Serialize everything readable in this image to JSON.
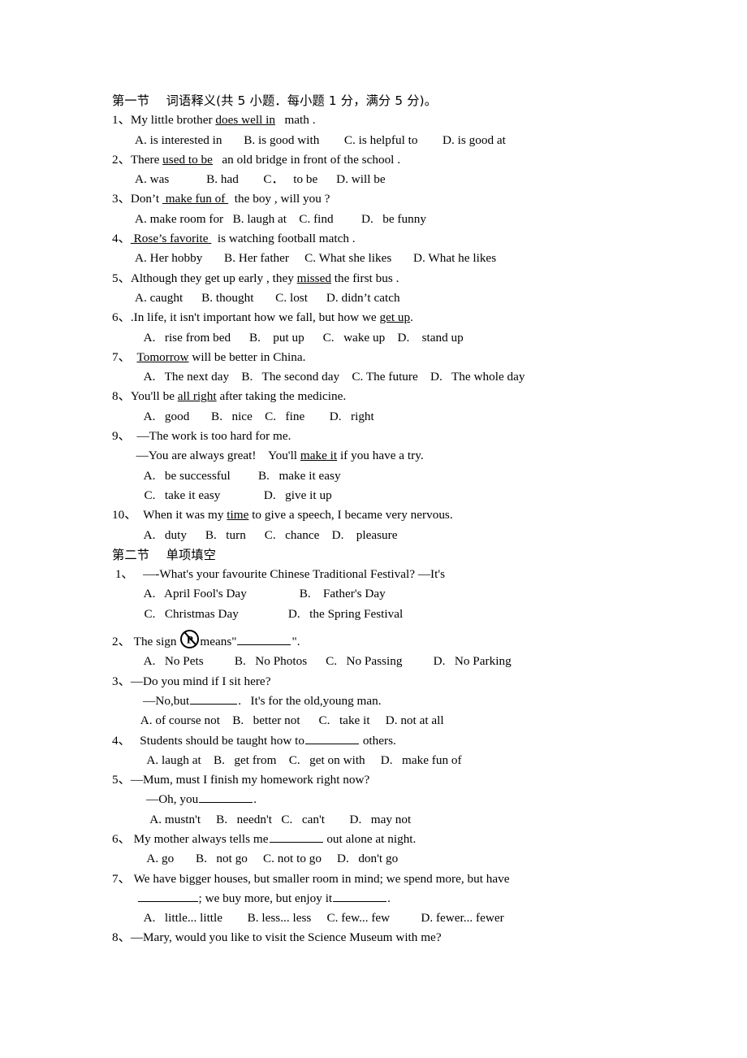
{
  "document": {
    "type": "english-exam-paper",
    "sections": [
      {
        "heading": "第一节　 词语释义(共 5 小题．每小题 1 分，满分 5 分)。",
        "questions": [
          {
            "number": "1、",
            "stem_pre": "My little brother ",
            "stem_underlined": "does well in",
            "stem_post": "   math .",
            "options_lines": [
              "A. is interested in       B. is good with        C. is helpful to        D. is good at"
            ]
          },
          {
            "number": "2、",
            "stem_pre": "There ",
            "stem_underlined": "used to be",
            "stem_post": "   an old bridge in front of the school .",
            "options_lines": [
              "A. was            B. had        C．   to be      D. will be"
            ]
          },
          {
            "number": "3、",
            "stem_pre": "Don’t ",
            "stem_underlined": " make fun of ",
            "stem_post": "  the boy , will you ?",
            "options_lines": [
              "A. make room for   B. laugh at    C. find         D.   be funny"
            ]
          },
          {
            "number": "4、",
            "stem_pre": "",
            "stem_underlined": " Rose’s favorite ",
            "stem_post": "  is watching football match .",
            "options_lines": [
              "A. Her hobby       B. Her father     C. What she likes       D. What he likes"
            ]
          },
          {
            "number": "5、",
            "stem_pre": "Although they get up early , they ",
            "stem_underlined": "missed",
            "stem_post": " the first bus .",
            "options_lines": [
              "A. caught      B. thought       C. lost      D. didn’t catch"
            ]
          },
          {
            "number": "6、",
            "stem_pre": ".In life, it isn't important how we fall, but how we ",
            "stem_underlined": "get up",
            "stem_post": ".",
            "options_lines": [
              "   A.   rise from bed      B.    put up      C.   wake up    D.    stand up"
            ]
          },
          {
            "number": "7、",
            "stem_pre": "  ",
            "stem_underlined": "Tomorrow",
            "stem_post": " will be better in China.",
            "options_lines": [
              "   A.   The next day    B.   The second day    C. The future    D.   The whole day"
            ]
          },
          {
            "number": "8、",
            "stem_pre": "You'll be ",
            "stem_underlined": "all right",
            "stem_post": " after taking the medicine.",
            "options_lines": [
              "   A.   good       B.   nice    C.   fine        D.   right"
            ]
          },
          {
            "number": "9、",
            "stem_pre": "  —The work is too hard for me.",
            "stem_underlined": "",
            "stem_post": "",
            "extra_stem_pre": "  —You are always great!    You'll ",
            "extra_stem_underlined": "make it",
            "extra_stem_post": " if you have a try.",
            "options_lines": [
              "   A.   be successful         B.   make it easy",
              "   C.   take it easy              D.   give it up"
            ]
          },
          {
            "number": "10、",
            "stem_pre": "  When it was my ",
            "stem_underlined": "time",
            "stem_post": " to give a speech, I became very nervous.",
            "options_lines": [
              "   A.   duty      B.   turn      C.   chance    D.    pleasure"
            ]
          }
        ]
      },
      {
        "heading": "第二节　 单项填空",
        "questions": [
          {
            "number": " 1、",
            "stem_pre": "   —-What's your favourite Chinese Traditional Festival? —It's",
            "stem_underlined": "",
            "stem_post": "",
            "options_lines": [
              "   A.   April Fool's Day                 B.    Father's Day",
              "   C.   Christmas Day                D.   the Spring Festival"
            ]
          },
          {
            "number": "2、",
            "stem_pre": " The sign ",
            "has_sign_icon": true,
            "sign_icon_name": "no-parking-sign-icon",
            "sign_icon_glyph": "P",
            "stem_mid": "means\"",
            "stem_has_blank": true,
            "stem_post": "\".",
            "options_lines": [
              "   A.   No Pets          B.   No Photos      C.   No Passing          D.   No Parking"
            ]
          },
          {
            "number": "3、",
            "stem_pre": "—Do you mind if I sit here?",
            "stem_underlined": "",
            "stem_post": "",
            "dialog_pre": "          —No,but",
            "dialog_has_blank": true,
            "dialog_post": ".   It's for the old,young man.",
            "options_lines": [
              "  A. of course not    B.   better not      C.   take it     D. not at all"
            ]
          },
          {
            "number": "4、",
            "stem_pre": "   Students should be taught how to",
            "stem_has_blank": true,
            "stem_post": " others.",
            "options_lines": [
              "    A. laugh at    B.   get from    C.   get on with     D.   make fun of"
            ]
          },
          {
            "number": "5、",
            "stem_pre": "—Mum, must I finish my homework right now?",
            "stem_underlined": "",
            "stem_post": "",
            "dialog_pre": "           —Oh, you",
            "dialog_has_blank": true,
            "dialog_post": ".",
            "options_lines": [
              "     A. mustn't     B.   needn't   C.   can't        D.   may not"
            ]
          },
          {
            "number": "6、",
            "stem_pre": " My mother always tells me",
            "stem_has_blank": true,
            "stem_post": " out alone at night.",
            "options_lines": [
              "    A. go       B.   not go     C. not to go     D.   don't go"
            ]
          },
          {
            "number": "7、",
            "stem_pre": " We have bigger houses, but smaller room in mind; we spend more, but have",
            "stem_underlined": "",
            "stem_post": "",
            "cont_pre": "        ",
            "cont_has_blank_lead": true,
            "cont_mid": "; we buy more, but enjoy it",
            "cont_has_blank_tail": true,
            "cont_post": ".",
            "options_lines": [
              "   A.   little... little        B. less... less     C. few... few          D. fewer... fewer"
            ]
          },
          {
            "number": "8、",
            "stem_pre": "—Mary, would you like to visit the Science Museum with me?",
            "stem_underlined": "",
            "stem_post": "",
            "options_lines": []
          }
        ]
      }
    ]
  }
}
